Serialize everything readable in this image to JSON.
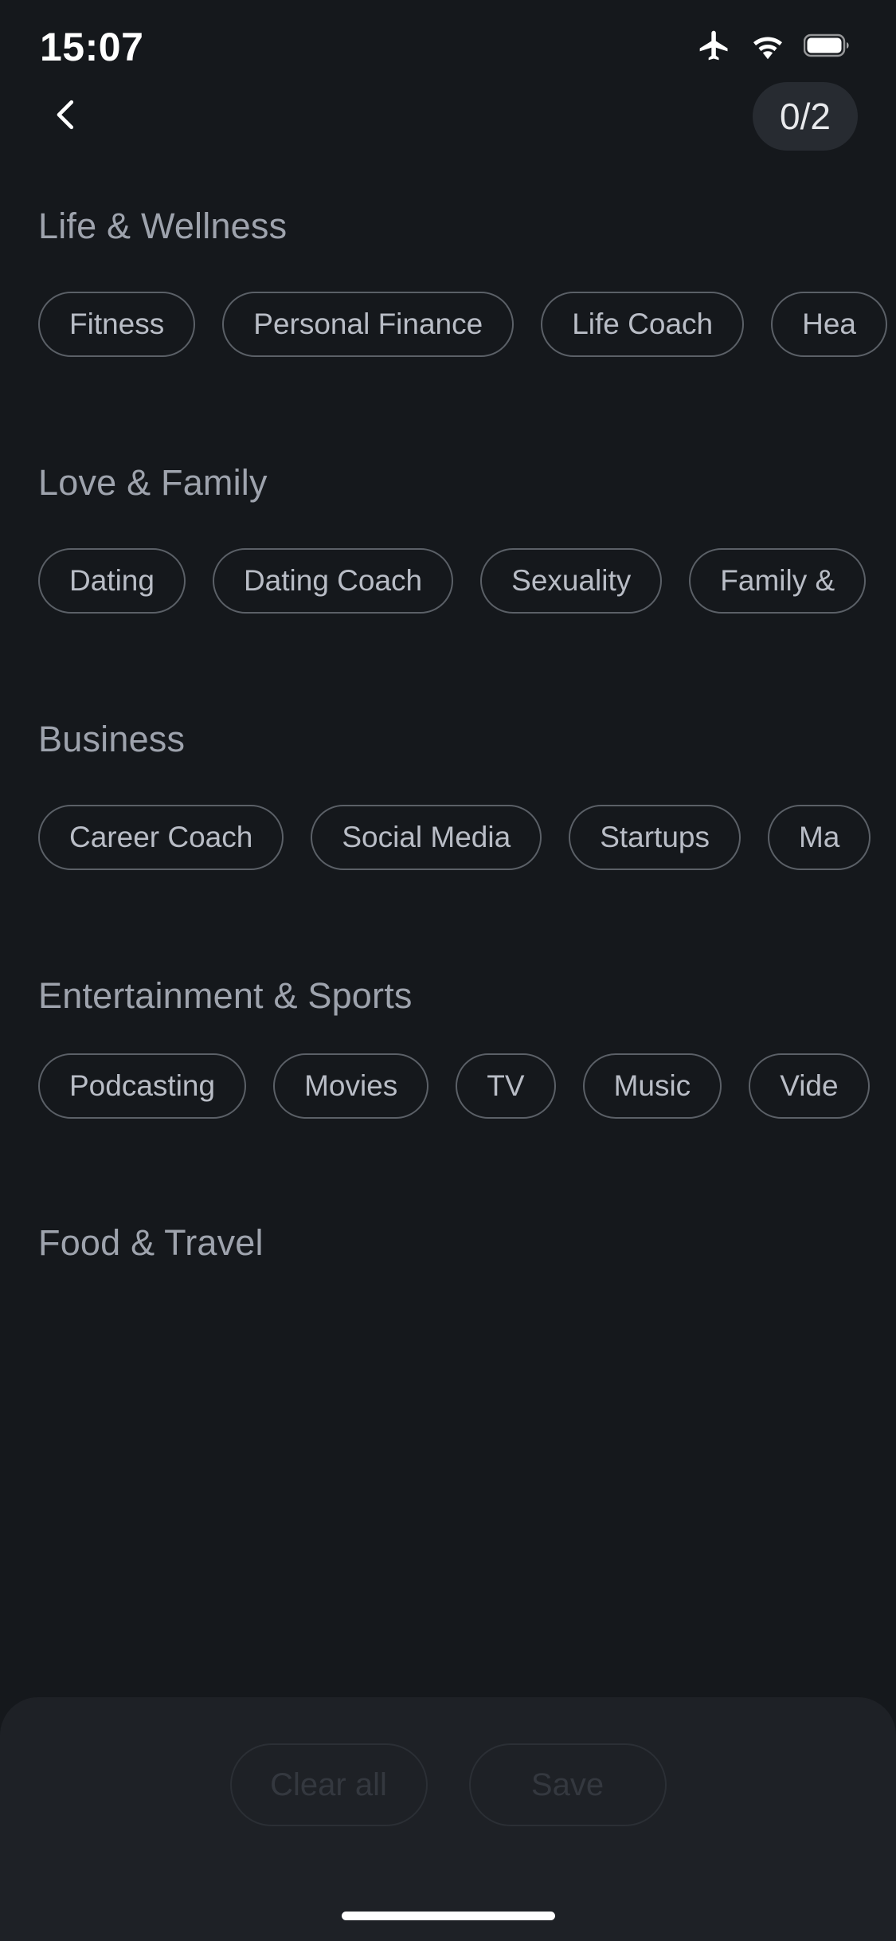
{
  "status_bar": {
    "time": "15:07",
    "icons": [
      "airplane-mode-icon",
      "wifi-icon",
      "battery-icon"
    ]
  },
  "nav": {
    "back_icon": "chevron-left-icon",
    "counter": "0/2"
  },
  "theme": {
    "background": "#15181c",
    "sheet_background": "#1e2126",
    "badge_background": "#272b31",
    "chip_border": "#5b6067",
    "chip_text": "#b9bdc6",
    "section_title": "#9ea3ad",
    "disabled_text": "#34383f"
  },
  "sections": [
    {
      "title": "Life & Wellness",
      "chips": [
        "Fitness",
        "Personal Finance",
        "Life Coach",
        "Hea"
      ]
    },
    {
      "title": "Love & Family",
      "chips": [
        "Dating",
        "Dating Coach",
        "Sexuality",
        "Family &"
      ]
    },
    {
      "title": "Business",
      "chips": [
        "Career Coach",
        "Social Media",
        "Startups",
        "Ma"
      ]
    },
    {
      "title": "Entertainment & Sports",
      "chips": [
        "Podcasting",
        "Movies",
        "TV",
        "Music",
        "Vide"
      ]
    },
    {
      "title": "Food & Travel",
      "chips": []
    }
  ],
  "bottom_bar": {
    "clear_label": "Clear all",
    "save_label": "Save"
  }
}
